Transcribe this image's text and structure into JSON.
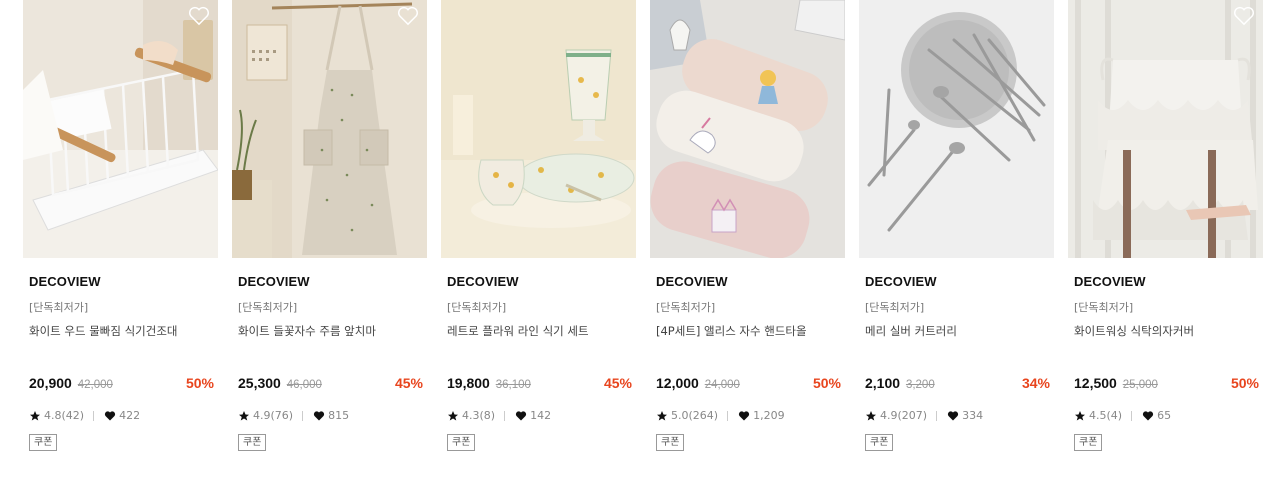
{
  "icons": {
    "wishlist": "heart-outline-icon",
    "rating": "star-icon",
    "likes": "heart-icon"
  },
  "colors": {
    "discount": "#e8451e"
  },
  "products": [
    {
      "brand": "DECOVIEW",
      "tag": "[단독최저가]",
      "name": "화이트 우드 물빠짐 식기건조대",
      "price": "20,900",
      "original_price": "42,000",
      "discount": "50%",
      "rating": "4.8(42)",
      "likes": "422",
      "badge": "쿠폰"
    },
    {
      "brand": "DECOVIEW",
      "tag": "[단독최저가]",
      "name": "화이트 들꽃자수 주름 앞치마",
      "price": "25,300",
      "original_price": "46,000",
      "discount": "45%",
      "rating": "4.9(76)",
      "likes": "815",
      "badge": "쿠폰"
    },
    {
      "brand": "DECOVIEW",
      "tag": "[단독최저가]",
      "name": "레트로 플라워 라인 식기 세트",
      "price": "19,800",
      "original_price": "36,100",
      "discount": "45%",
      "rating": "4.3(8)",
      "likes": "142",
      "badge": "쿠폰"
    },
    {
      "brand": "DECOVIEW",
      "tag": "[단독최저가]",
      "name": "[4P세트] 앨리스 자수 핸드타올",
      "price": "12,000",
      "original_price": "24,000",
      "discount": "50%",
      "rating": "5.0(264)",
      "likes": "1,209",
      "badge": "쿠폰"
    },
    {
      "brand": "DECOVIEW",
      "tag": "[단독최저가]",
      "name": "메리 실버 커트러리",
      "price": "2,100",
      "original_price": "3,200",
      "discount": "34%",
      "rating": "4.9(207)",
      "likes": "334",
      "badge": "쿠폰"
    },
    {
      "brand": "DECOVIEW",
      "tag": "[단독최저가]",
      "name": "화이트워싱 식탁의자커버",
      "price": "12,500",
      "original_price": "25,000",
      "discount": "50%",
      "rating": "4.5(4)",
      "likes": "65",
      "badge": "쿠폰"
    }
  ]
}
